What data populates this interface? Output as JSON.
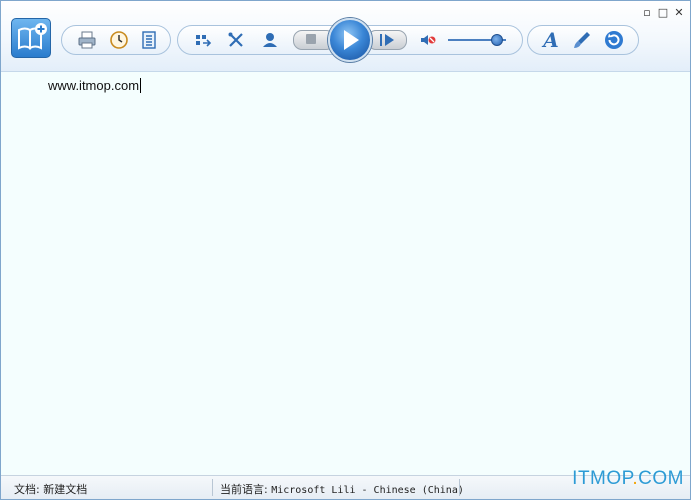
{
  "window": {
    "controls": {
      "minimize": "▫",
      "maximize": "□",
      "close": "✕"
    }
  },
  "toolbar": {
    "icons": [
      "logo-book-icon",
      "print-icon",
      "clock-icon",
      "list-icon",
      "export-icon",
      "tools-icon",
      "user-icon",
      "stop-icon",
      "play-icon",
      "next-icon",
      "volume-icon",
      "font-icon",
      "brush-icon",
      "refresh-icon"
    ],
    "volume_level": 0.85,
    "font_label": "A"
  },
  "document": {
    "text": "www.itmop.com"
  },
  "statusbar": {
    "doc_label": "文档: 新建文档",
    "lang_label": "当前语言: ",
    "lang_value": "Microsoft Lili - Chinese (China)"
  },
  "watermark": {
    "main": "ITMOP",
    "accent": ".",
    "tail": "COM"
  },
  "colors": {
    "accent": "#2a7ccd",
    "watermark": "#2d9bd5",
    "watermark_dot": "#f2a200"
  }
}
